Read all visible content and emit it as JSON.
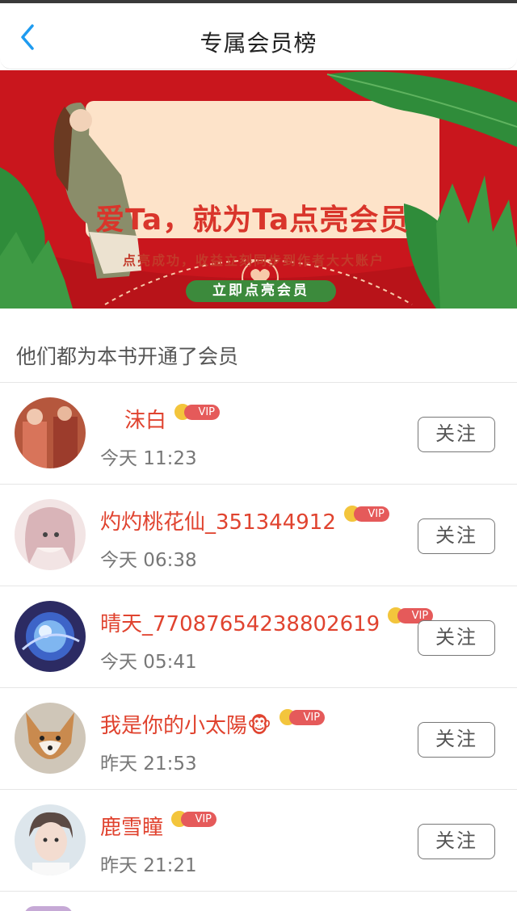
{
  "nav": {
    "title": "专属会员榜"
  },
  "banner": {
    "title": "爱Ta，就为Ta点亮会员",
    "subtitle": "点亮成功，收益立刻同步到作者大大账户",
    "button_label": "立即点亮会员",
    "colors": {
      "background": "#c9161d",
      "card": "#fde3c9",
      "button": "#3c8a3c"
    }
  },
  "section": {
    "header": "他们都为本书开通了会员"
  },
  "members": [
    {
      "name": "沫白",
      "badge": "VIP",
      "time": "今天 11:23",
      "follow_label": "关注"
    },
    {
      "name": "灼灼桃花仙_351344912",
      "badge": "VIP",
      "time": "今天 06:38",
      "follow_label": "关注"
    },
    {
      "name": "晴天_77087654238802619",
      "badge": "VIP",
      "time": "今天 05:41",
      "follow_label": "关注"
    },
    {
      "name": "我是你的小太陽🐵",
      "badge": "VIP",
      "time": "昨天 21:53",
      "follow_label": "关注"
    },
    {
      "name": "鹿雪瞳",
      "badge": "VIP",
      "time": "昨天 21:21",
      "follow_label": "关注"
    }
  ],
  "colors": {
    "accent": "#1e9bf0",
    "name": "#e0432f",
    "vip": "#e55a5a",
    "crown": "#f3c53c"
  }
}
